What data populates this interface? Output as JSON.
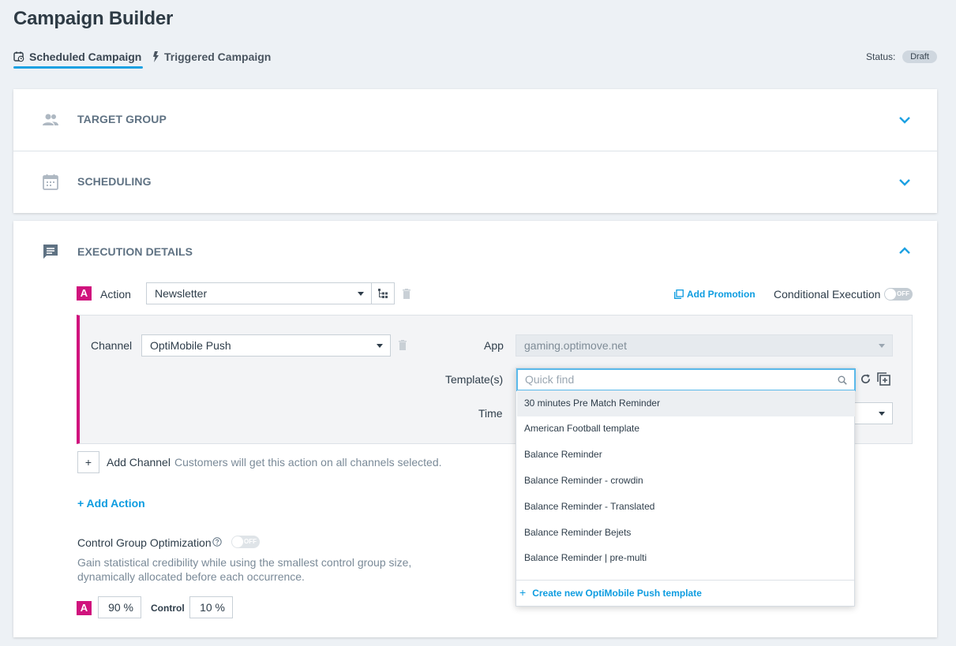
{
  "page_title": "Campaign Builder",
  "tabs": [
    {
      "label": "Scheduled Campaign",
      "active": true,
      "icon": "calendar-clock-icon"
    },
    {
      "label": "Triggered Campaign",
      "active": false,
      "icon": "lightning-icon"
    }
  ],
  "status": {
    "label": "Status:",
    "value": "Draft"
  },
  "sections": {
    "target_group": {
      "title": "TARGET GROUP",
      "icon": "people-icon",
      "expanded": false
    },
    "scheduling": {
      "title": "SCHEDULING",
      "icon": "calendar-icon",
      "expanded": false
    },
    "execution": {
      "title": "EXECUTION DETAILS",
      "icon": "message-icon",
      "expanded": true
    }
  },
  "action": {
    "badge": "A",
    "label": "Action",
    "value": "Newsletter",
    "add_promotion": "Add Promotion",
    "conditional_execution": "Conditional Execution",
    "conditional_toggle": "OFF"
  },
  "channel": {
    "label": "Channel",
    "value": "OptiMobile Push",
    "app_label": "App",
    "app_value": "gaming.optimove.net",
    "templates_label": "Template(s)",
    "time_label": "Time"
  },
  "template_dropdown": {
    "placeholder": "Quick find",
    "items": [
      "30 minutes Pre Match Reminder",
      "American Football template",
      "Balance Reminder",
      "Balance Reminder - crowdin",
      "Balance Reminder - Translated",
      "Balance Reminder Bejets",
      "Balance Reminder | pre-multi"
    ],
    "footer": "Create new OptiMobile Push template"
  },
  "add_channel": {
    "plus": "+",
    "label": "Add Channel",
    "hint": "Customers will get this action on all channels selected."
  },
  "add_action": "+ Add Action",
  "control_group": {
    "label": "Control Group Optimization",
    "toggle": "OFF",
    "description_line1": "Gain statistical credibility while using the smallest control group size,",
    "description_line2": "dynamically allocated before each occurrence.",
    "badge": "A",
    "action_pct": "90 %",
    "control_label": "Control",
    "control_pct": "10 %"
  },
  "colors": {
    "accent": "#1da1e2",
    "action_badge": "#d0137d",
    "link": "#0d9ce0"
  }
}
